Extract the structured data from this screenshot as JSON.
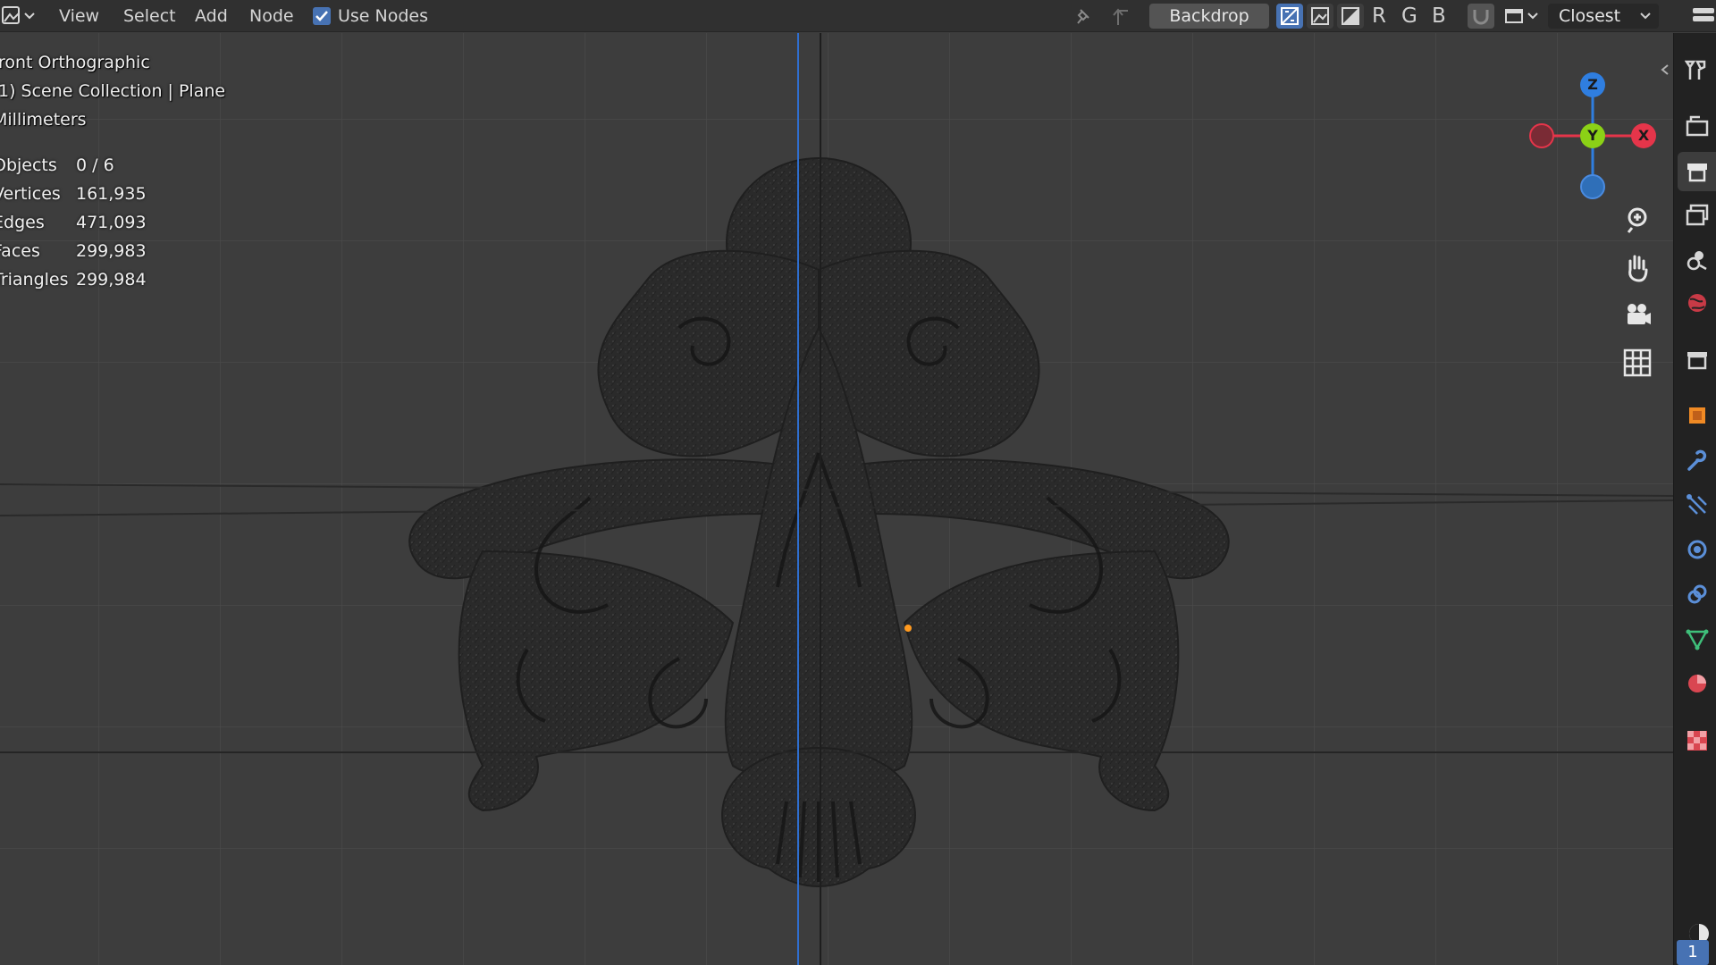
{
  "header": {
    "menu": [
      "View",
      "Select",
      "Add",
      "Node"
    ],
    "use_nodes_label": "Use Nodes",
    "use_nodes_checked": true,
    "backdrop_label": "Backdrop",
    "channels": [
      "R",
      "G",
      "B"
    ],
    "interpolation": "Closest"
  },
  "overlay": {
    "view_name": "ront Orthographic",
    "collection": "1) Scene Collection | Plane",
    "units": "Millimeters",
    "stats": [
      {
        "label": "Objects",
        "value": "0 / 6"
      },
      {
        "label": "Vertices",
        "value": "161,935"
      },
      {
        "label": "Edges",
        "value": "471,093"
      },
      {
        "label": "Faces",
        "value": "299,983"
      },
      {
        "label": "Triangles",
        "value": "299,984"
      }
    ]
  },
  "gizmo": {
    "axes": {
      "z": "Z",
      "y": "Y",
      "x": "X"
    },
    "colors": {
      "x": "#e5354a",
      "y": "#8bd116",
      "z": "#2f7ee0"
    }
  },
  "navigation": [
    "zoom-icon",
    "pan-hand-icon",
    "camera-icon",
    "grid-icon"
  ],
  "properties_tabs": [
    "tool-icon",
    "render-icon",
    "output-icon",
    "view-layer-icon",
    "scene-icon",
    "world-icon",
    "collection-icon",
    "object-icon",
    "modifier-icon",
    "particles-icon",
    "physics-icon",
    "constraints-icon",
    "data-icon",
    "material-icon",
    "texture-icon"
  ],
  "footer": {
    "page": "1"
  },
  "colors": {
    "accent": "#4772b3",
    "viewport_bg": "#3d3d3d",
    "header_bg": "#303030",
    "origin": "#ff9a1f"
  }
}
